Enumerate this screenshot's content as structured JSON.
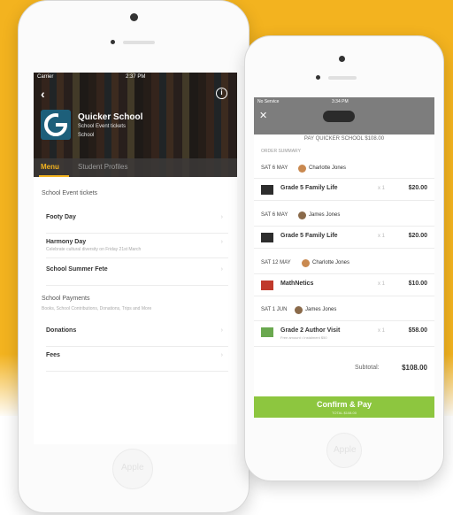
{
  "left_phone": {
    "status": {
      "carrier": "Carrier",
      "time": "2:37 PM"
    },
    "school": {
      "name": "Quicker School",
      "subtitle": "School Event tickets",
      "category": "School"
    },
    "tabs": [
      {
        "label": "Menu"
      },
      {
        "label": "Student Profiles"
      }
    ],
    "sections": [
      {
        "title": "School Event tickets",
        "subtitle": ""
      },
      {
        "title": "School Payments",
        "subtitle": "Books, School Contributions, Donations, Trips and More"
      }
    ],
    "items": [
      {
        "label": "Footy Day",
        "sub": ""
      },
      {
        "label": "Harmony Day",
        "sub": "Celebrate cultural diversity on Friday 21st March"
      },
      {
        "label": "School Summer Fete",
        "sub": ""
      },
      {
        "label": "Donations",
        "sub": ""
      },
      {
        "label": "Fees",
        "sub": ""
      }
    ],
    "chevron": "›",
    "home_label": "Apple"
  },
  "right_phone": {
    "status": {
      "carrier": "No Service",
      "time": "3:34 PM"
    },
    "close": "✕",
    "pay_title": "PAY QUICKER SCHOOL $108.00",
    "order_summary": "ORDER SUMMARY",
    "groups": [
      {
        "date": "SAT 6 MAY",
        "person": "Charlotte Jones",
        "item": "Grade 5 Family Life",
        "sub": "",
        "qty": "x 1",
        "price": "$20.00"
      },
      {
        "date": "SAT 6 MAY",
        "person": "James Jones",
        "item": "Grade 5 Family Life",
        "sub": "",
        "qty": "x 1",
        "price": "$20.00"
      },
      {
        "date": "SAT 12 MAY",
        "person": "Charlotte Jones",
        "item": "MathNetics",
        "sub": "",
        "qty": "x 1",
        "price": "$10.00"
      },
      {
        "date": "SAT 1 JUN",
        "person": "James Jones",
        "item": "Grade 2 Author Visit",
        "sub": "Free amount • Instalment $50",
        "qty": "x 1",
        "price": "$58.00"
      }
    ],
    "subtotal_label": "Subtotal:",
    "subtotal_value": "$108.00",
    "confirm_label": "Confirm & Pay",
    "confirm_sub": "TOTAL $108.00",
    "home_label": "Apple"
  },
  "colors": {
    "accent": "#f3b31f",
    "confirm": "#8dc63f"
  }
}
